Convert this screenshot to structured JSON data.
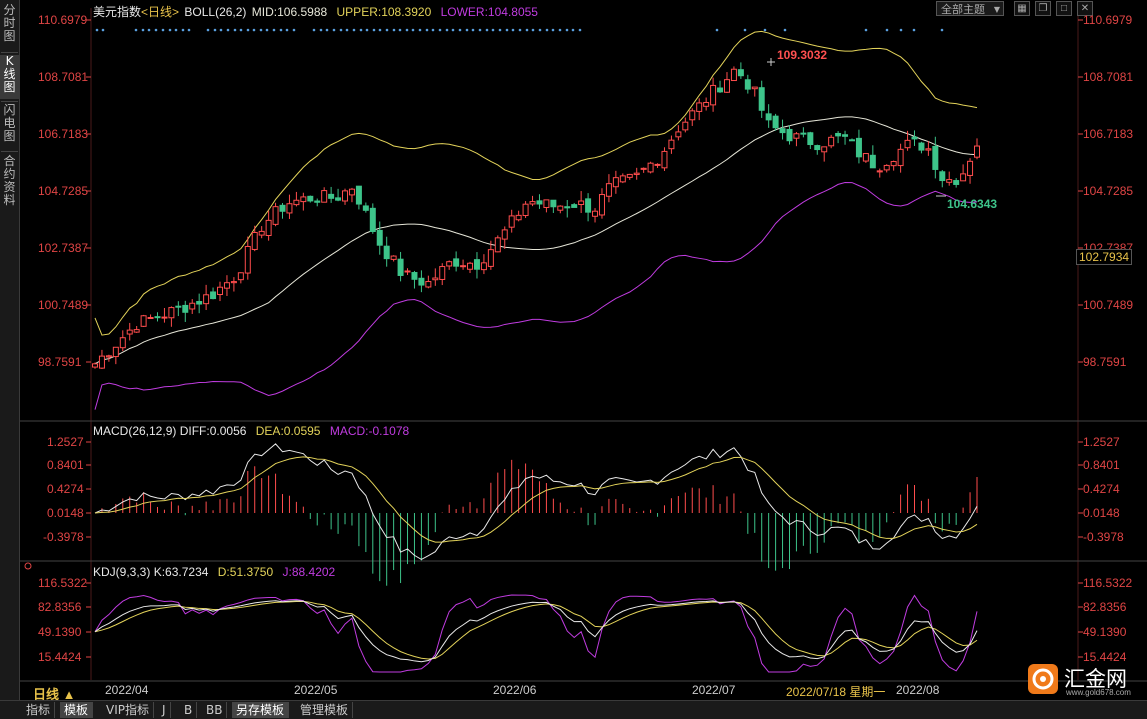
{
  "sidebar": {
    "tabs": [
      {
        "label": "分时图",
        "active": false
      },
      {
        "label": "K线图",
        "active": true
      },
      {
        "label": "闪电图",
        "active": false
      },
      {
        "label": "合约资料",
        "active": false
      }
    ]
  },
  "header": {
    "symbol": "美元指数",
    "period": "<日线>",
    "indicator": "BOLL(26,2)",
    "mid": "MID:106.5988",
    "upper": "UPPER:108.3920",
    "lower": "LOWER:104.8055",
    "theme_button": "全部主题",
    "icons": [
      "grid-icon",
      "copy-icon",
      "restore-icon",
      "close-icon"
    ]
  },
  "main_axis": {
    "ticks": [
      "110.6979",
      "108.7081",
      "106.7183",
      "104.7285",
      "102.7387",
      "100.7489",
      "98.7591"
    ],
    "current_price": "102.7934",
    "high_label": "109.3032",
    "low_label": "104.6343"
  },
  "macd": {
    "title": "MACD(26,12,9)",
    "diff": "DIFF:0.0056",
    "dea": "DEA:0.0595",
    "macd": "MACD:-0.1078",
    "ticks": [
      "1.2527",
      "0.8401",
      "0.4274",
      "0.0148",
      "-0.3978"
    ]
  },
  "kdj": {
    "title": "KDJ(9,3,3)",
    "k": "K:63.7234",
    "d": "D:51.3750",
    "j": "J:88.4202",
    "ticks": [
      "116.5322",
      "82.8356",
      "49.1390",
      "15.4424"
    ]
  },
  "xaxis": {
    "period_label": "日线 ▲",
    "dates": [
      "2022/04",
      "2022/05",
      "2022/06",
      "2022/07",
      "2022/08"
    ],
    "cursor_date": "2022/07/18 星期一"
  },
  "bottom_tabs": [
    "指标",
    "模板",
    "VIP指标",
    "J",
    "B",
    "BB",
    "另存模板",
    "管理模板"
  ],
  "logo": {
    "text": "汇金网",
    "url": "www.gold678.com"
  },
  "colors": {
    "up": "#ff4d4d",
    "down": "#3dc48a",
    "mid": "#e6e6d8",
    "upper": "#e3d35a",
    "lower": "#c03ce0",
    "axis": "#e04545",
    "period": "#e8c24a"
  }
}
